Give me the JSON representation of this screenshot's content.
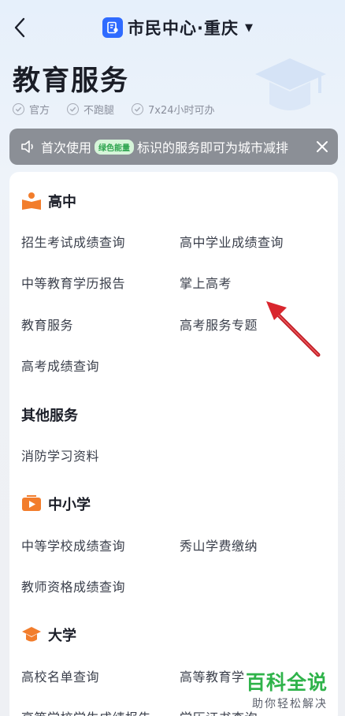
{
  "header": {
    "app_title": "市民中心·重庆",
    "caret": "▼"
  },
  "page": {
    "title": "教育服务",
    "badges": [
      "官方",
      "不跑腿",
      "7x24小时可办"
    ]
  },
  "notice": {
    "text_before": "首次使用",
    "green_tag": "绿色能量",
    "text_after": "标识的服务即可为城市减排"
  },
  "sections": {
    "gaozhong": {
      "title": "高中",
      "items": [
        "招生考试成绩查询",
        "高中学业成绩查询",
        "中等教育学历报告",
        "掌上高考",
        "教育服务",
        "高考服务专题",
        "高考成绩查询"
      ]
    },
    "other": {
      "title": "其他服务",
      "items": [
        "消防学习资料"
      ]
    },
    "zhongxiaoxue": {
      "title": "中小学",
      "items": [
        "中等学校成绩查询",
        "秀山学费缴纳",
        "教师资格成绩查询"
      ]
    },
    "daxue": {
      "title": "大学",
      "items": [
        "高校名单查询",
        "高等教育学",
        "高等学校学生成绩报告",
        "学历证书查询"
      ]
    }
  },
  "watermark": {
    "big": "百科全说",
    "small": "助你轻松解决"
  },
  "colors": {
    "accent_blue": "#2f6bff",
    "icon_orange": "#f27d2c",
    "watermark_green": "#2fb34a",
    "arrow_red": "#d9262e"
  }
}
